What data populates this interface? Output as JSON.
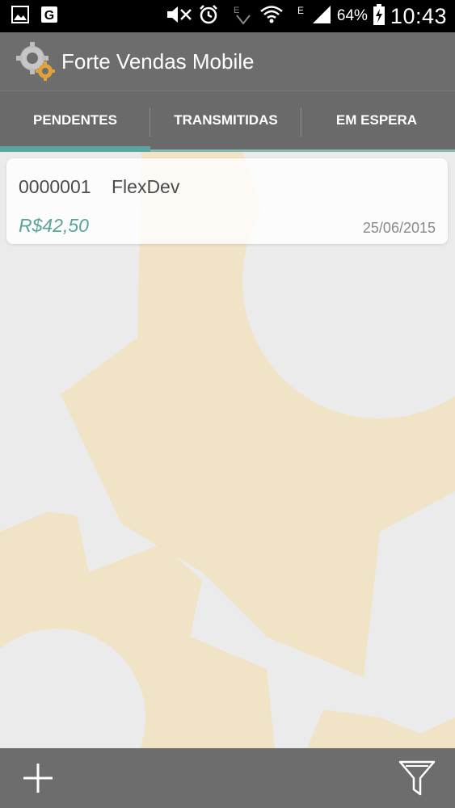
{
  "status_bar": {
    "battery": "64%",
    "time": "10:43",
    "icons": [
      "gallery-icon",
      "g-app-icon",
      "mute-icon",
      "alarm-icon",
      "signal-arrows-icon",
      "wifi-icon",
      "edge-network-icon",
      "cell-signal-icon",
      "battery-charging-icon"
    ]
  },
  "app_bar": {
    "title": "Forte Vendas Mobile",
    "icon": "gears-logo-icon"
  },
  "tabs": [
    {
      "label": "PENDENTES",
      "active": true
    },
    {
      "label": "TRANSMITIDAS",
      "active": false
    },
    {
      "label": "EM ESPERA",
      "active": false
    }
  ],
  "orders": [
    {
      "code": "0000001",
      "client": "FlexDev",
      "value": "R$42,50",
      "date": "25/06/2015"
    }
  ],
  "bottom_bar": {
    "add_icon": "plus-icon",
    "filter_icon": "filter-icon"
  },
  "colors": {
    "accent": "#5aa7a0",
    "bar": "#6d6d6d",
    "value_text": "#5aa39b"
  }
}
